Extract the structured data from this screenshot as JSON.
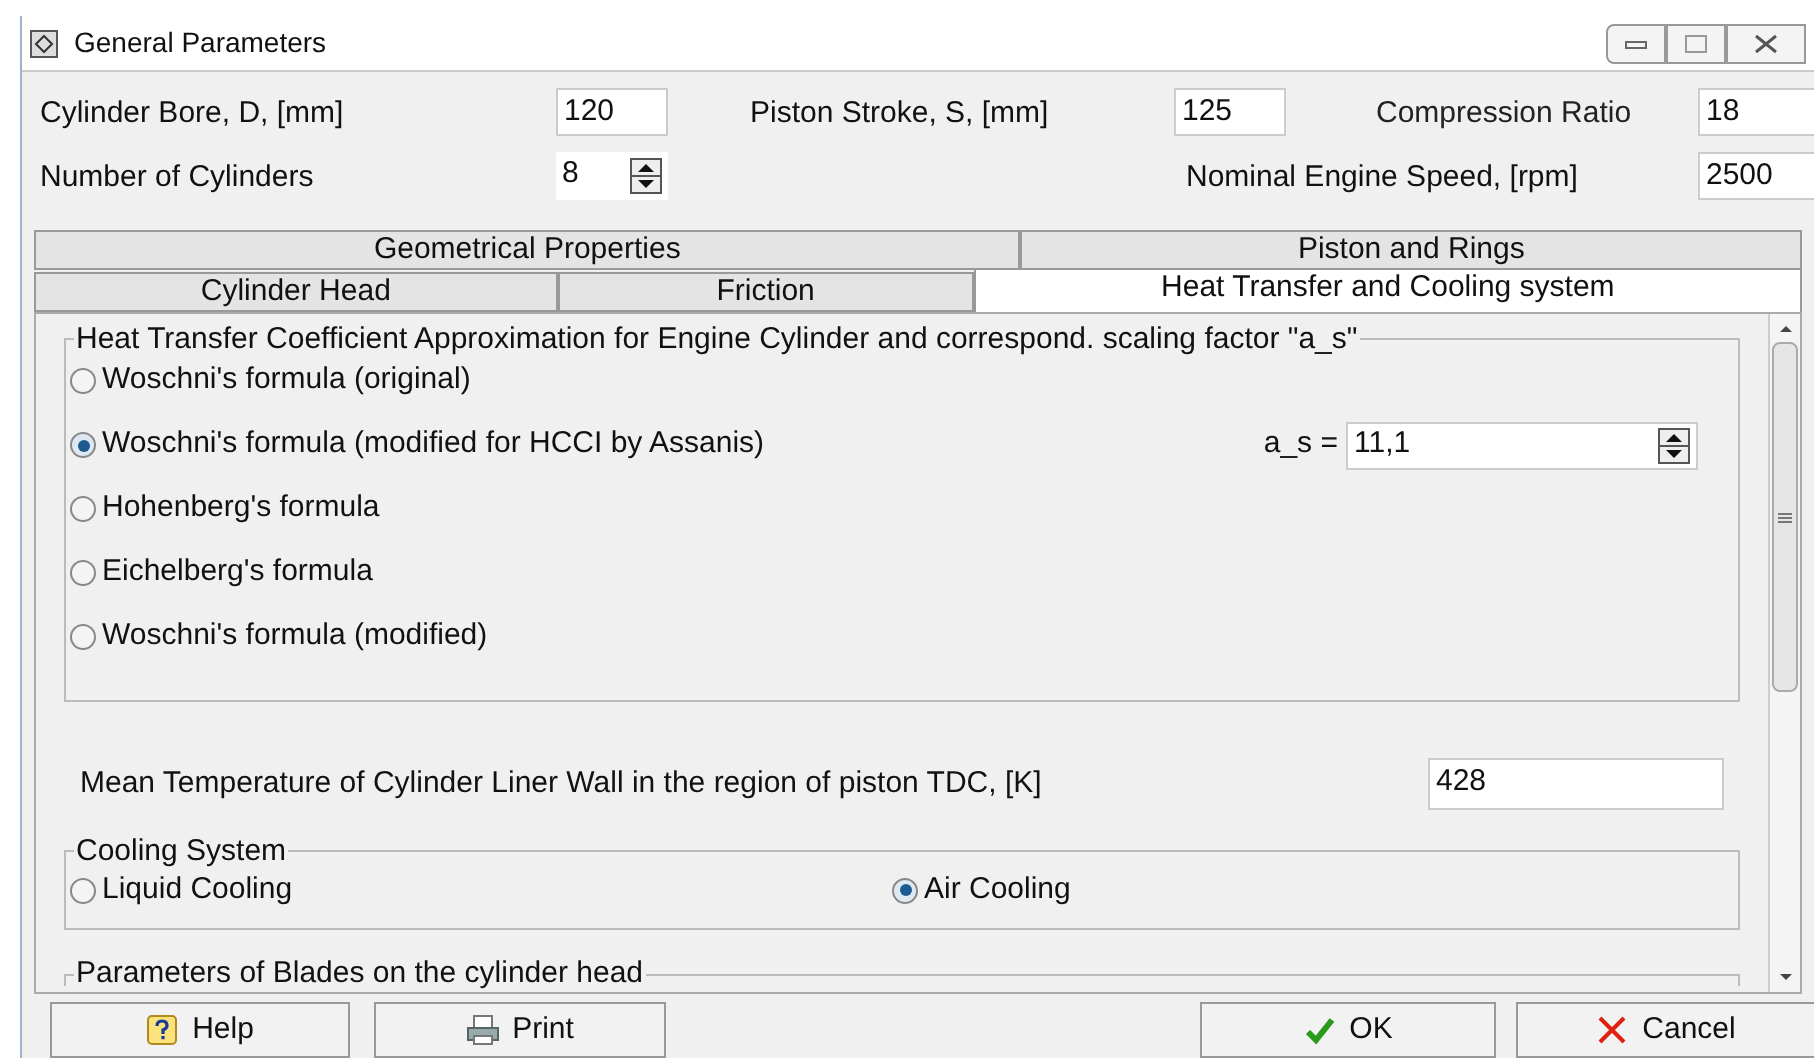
{
  "window": {
    "title": "General Parameters"
  },
  "params": [
    {
      "label": "Cylinder Bore, D, [mm]",
      "value": "120",
      "kind": "text"
    },
    {
      "label": "Piston Stroke, S, [mm]",
      "value": "125",
      "kind": "text"
    },
    {
      "label": "Compression Ratio",
      "value": "18",
      "kind": "text"
    },
    {
      "label": "Number of Cylinders",
      "value": "8",
      "kind": "spin"
    },
    {
      "label": "Nominal Engine Speed, [rpm]",
      "value": "2500",
      "kind": "text"
    }
  ],
  "tab_rows": [
    [
      {
        "label": "Geometrical Properties",
        "selected": false
      },
      {
        "label": "Piston and Rings",
        "selected": false
      }
    ],
    [
      {
        "label": "Cylinder Head",
        "selected": false
      },
      {
        "label": "Friction",
        "selected": false
      },
      {
        "label": "Heat Transfer and Cooling system",
        "selected": true
      }
    ]
  ],
  "heat_transfer": {
    "title": "Heat Transfer Coefficient Approximation for Engine Cylinder and correspond. scaling factor \"a_s\"",
    "options": [
      {
        "label": "Woschni's formula (original)",
        "selected": false
      },
      {
        "label": "Woschni's formula (modified for HCCI by Assanis)",
        "selected": true
      },
      {
        "label": "Hohenberg's formula",
        "selected": false
      },
      {
        "label": "Eichelberg's formula",
        "selected": false
      },
      {
        "label": "Woschni's formula (modified)",
        "selected": false
      }
    ],
    "scale_label": "a_s =",
    "scale_value": "11,1"
  },
  "wall_temperature": {
    "label": "Mean Temperature of Cylinder Liner Wall in the region of piston TDC, [K]",
    "value": "428"
  },
  "cooling": {
    "title": "Cooling System",
    "options": [
      {
        "label": "Liquid Cooling",
        "selected": false
      },
      {
        "label": "Air Cooling",
        "selected": true
      }
    ]
  },
  "blades": {
    "title": "Parameters of Blades on the cylinder head"
  },
  "buttons": [
    {
      "label": "Help",
      "kind": "help"
    },
    {
      "label": "Print",
      "kind": "print"
    },
    {
      "label": "OK",
      "kind": "ok"
    },
    {
      "label": "Cancel",
      "kind": "cancel"
    }
  ]
}
